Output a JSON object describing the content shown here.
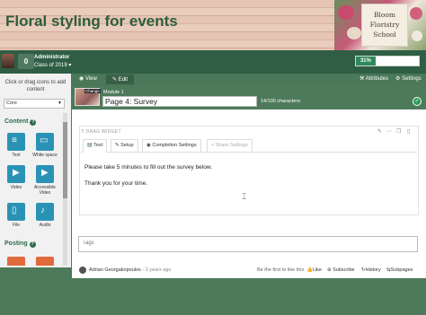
{
  "banner": {
    "site_title": "Floral styling for events",
    "logo_lines": [
      "Bloom",
      "Floristry",
      "School"
    ]
  },
  "account": {
    "points": "0",
    "role": "Administrator",
    "class_year": "Class of 2019",
    "class_chevron": "▾",
    "progress_label": "31%",
    "progress_value": 0.31
  },
  "toolbar": {
    "view_label": "View",
    "edit_label": "Edit",
    "attributes_label": "Attributes",
    "settings_label": "Settings"
  },
  "sidebar": {
    "hint": "Click or drag icons to add content",
    "select_value": "Core",
    "content_heading": "Content",
    "posting_heading": "Posting",
    "tiles": [
      {
        "label": "Text",
        "icon": "text-icon"
      },
      {
        "label": "White space",
        "icon": "white-space-icon"
      },
      {
        "label": "Video",
        "icon": "video-icon"
      },
      {
        "label": "Accessible Video",
        "icon": "accessible-video-icon"
      },
      {
        "label": "File",
        "icon": "file-icon"
      },
      {
        "label": "Audio",
        "icon": "audio-icon"
      }
    ]
  },
  "page": {
    "thumb_label": "Change",
    "module": "Module 1",
    "title": "Page 4: Survey",
    "char_count": "14/100 characters"
  },
  "widget": {
    "drag_label": "DRAG WIDGET",
    "tabs": [
      {
        "label": "Text",
        "icon": "▤"
      },
      {
        "label": "Setup",
        "icon": "✎"
      },
      {
        "label": "Completion Settings",
        "icon": "◉"
      },
      {
        "label": "Share Settings",
        "icon": "<"
      }
    ],
    "paragraph_1": "Please take 5 minutes to fill out the survey below.",
    "paragraph_2": "Thank you for your time."
  },
  "tags": {
    "placeholder": "Tags"
  },
  "footer": {
    "author": "Adrian Georgakopoulos",
    "time": "- 2 years ago",
    "first_like": "Be the first to like this",
    "like": "Like",
    "subscribe": "Subscribe",
    "history": "History",
    "subpages": "Subpages"
  },
  "colors": {
    "brand_green": "#2f5e45",
    "page_green": "#4d7a5a",
    "tile_blue": "#2a93b5",
    "progress_green": "#2e8a5a",
    "title_green": "#2d5e3c"
  }
}
